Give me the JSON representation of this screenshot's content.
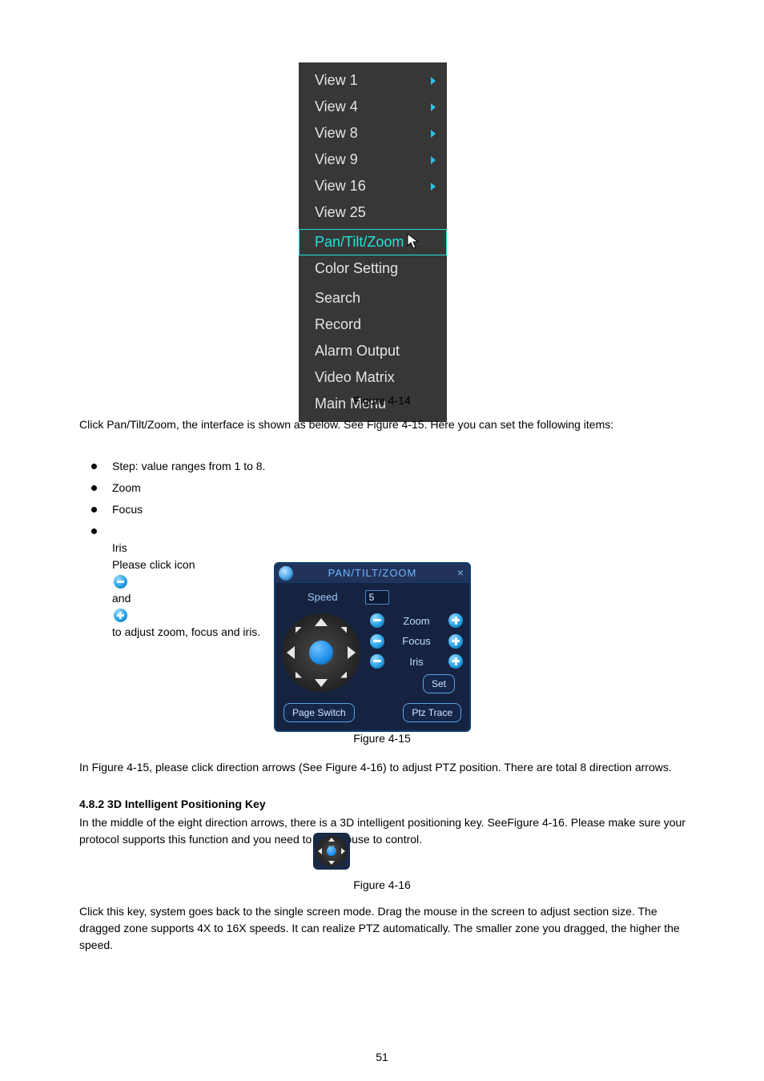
{
  "context_menu": {
    "items": [
      {
        "label": "View 1",
        "submenu": true
      },
      {
        "label": "View 4",
        "submenu": true
      },
      {
        "label": "View 8",
        "submenu": true
      },
      {
        "label": "View 9",
        "submenu": true
      },
      {
        "label": "View 16",
        "submenu": true
      },
      {
        "label": "View 25",
        "submenu": false
      }
    ],
    "section2": [
      {
        "label": "Pan/Tilt/Zoom",
        "highlight": true
      },
      {
        "label": "Color Setting"
      }
    ],
    "section3": [
      {
        "label": "Search"
      },
      {
        "label": "Record"
      },
      {
        "label": "Alarm Output"
      },
      {
        "label": "Video Matrix"
      },
      {
        "label": "Main Menu"
      }
    ]
  },
  "figure1_caption": "Figure 4-14",
  "paragraph1": "Click Pan/Tilt/Zoom, the interface is shown as below. See Figure 4-15. Here you can set the following items:",
  "bullets": {
    "b1": "Step: value ranges from 1 to 8.",
    "b2": "Zoom",
    "b3": "Focus",
    "b4_pre": "Iris\nPlease click icon ",
    "b4_mid": " and ",
    "b4_post": " to adjust zoom, focus and iris."
  },
  "ptz_panel": {
    "title": "PAN/TILT/ZOOM",
    "speed_label": "Speed",
    "speed_value": "5",
    "rows": [
      {
        "label": "Zoom"
      },
      {
        "label": "Focus"
      },
      {
        "label": "Iris"
      }
    ],
    "set_btn": "Set",
    "page_switch_btn": "Page Switch",
    "ptz_trace_btn": "Ptz Trace"
  },
  "figure2_caption": "Figure 4-15",
  "paragraph2": "In Figure 4-15, please click direction arrows (See Figure 4-16) to adjust PTZ position. There are total 8 direction arrows.",
  "section_heading": "4.8.2 3D Intelligent Positioning Key",
  "paragraph3": "In the middle of the eight direction arrows, there is a 3D intelligent positioning key. SeeFigure 4-16. Please make sure your protocol supports this function and you need to use mouse to control.",
  "mini_dpad_center": "SIT",
  "figure3_caption": "Figure 4-16",
  "paragraph4": "Click this key, system goes back to the single screen mode. Drag the mouse in the screen to adjust section size. The dragged zone supports 4X to 16X speeds. It can realize PTZ automatically. The smaller zone you dragged, the higher the speed.",
  "page_number": "51"
}
